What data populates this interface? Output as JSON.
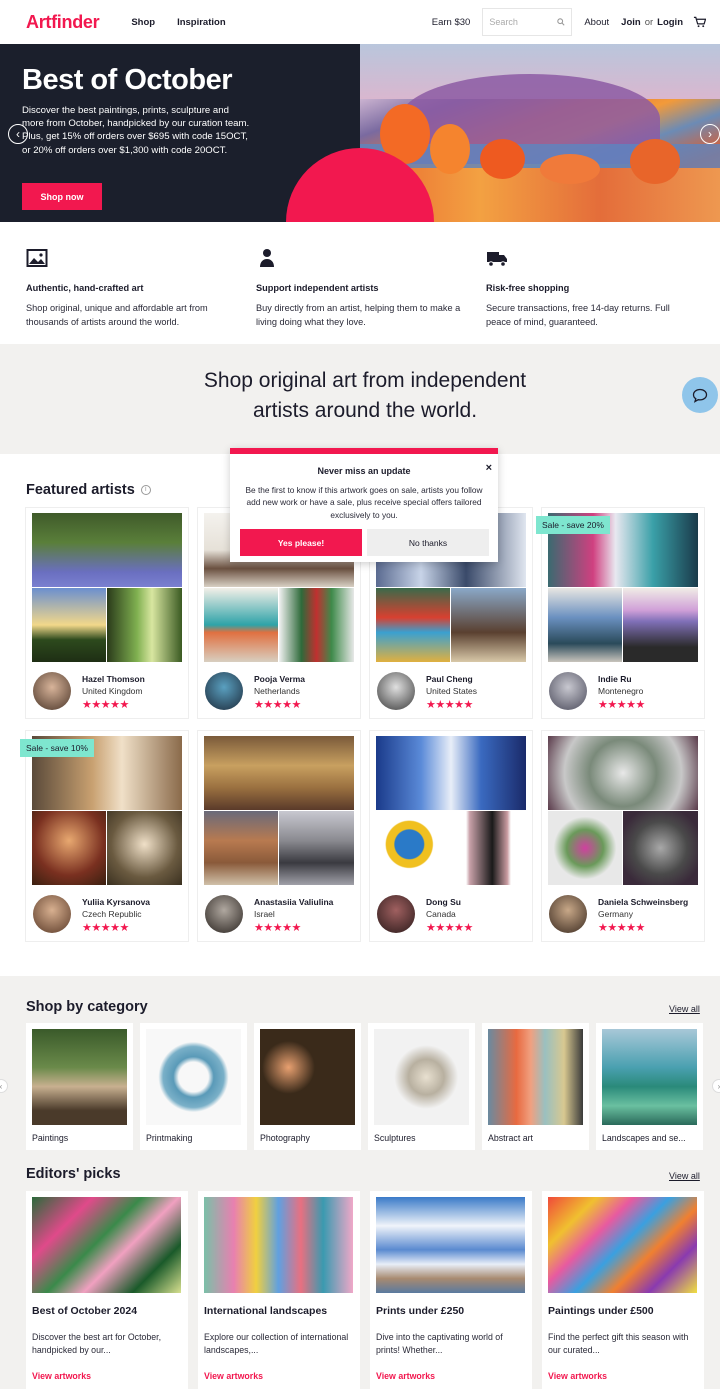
{
  "header": {
    "logo": "Artfinder",
    "nav": [
      "Shop",
      "Inspiration"
    ],
    "earn": "Earn $30",
    "search_placeholder": "Search",
    "about": "About",
    "join": "Join",
    "or": "or",
    "login": "Login"
  },
  "hero": {
    "title": "Best of October",
    "text": "Discover the best paintings, prints, sculpture and more from October, handpicked by our curation team. Plus, get 15% off orders over $695 with code 15OCT, or 20% off orders over $1,300 with code 20OCT.",
    "button": "Shop now"
  },
  "features": [
    {
      "icon": "image-icon",
      "title": "Authentic, hand-crafted art",
      "text": "Shop original, unique and affordable art from thousands of artists around the world."
    },
    {
      "icon": "person-icon",
      "title": "Support independent artists",
      "text": "Buy directly from an artist, helping them to make a living doing what they love."
    },
    {
      "icon": "truck-icon",
      "title": "Risk-free shopping",
      "text": "Secure transactions, free 14-day returns. Full peace of mind, guaranteed."
    }
  ],
  "banner": {
    "line1": "Shop original art from independent",
    "line2": "artists around the world."
  },
  "featured": {
    "title": "Featured artists",
    "artists": [
      {
        "name": "Hazel Thomson",
        "country": "United Kingdom",
        "rating": 5
      },
      {
        "name": "Pooja Verma",
        "country": "Netherlands",
        "rating": 5
      },
      {
        "name": "Paul Cheng",
        "country": "United States",
        "rating": 5
      },
      {
        "name": "Indie Ru",
        "country": "Montenegro",
        "rating": 5,
        "badge": "Sale - save 20%"
      },
      {
        "name": "Yuliia Kyrsanova",
        "country": "Czech Republic",
        "rating": 5,
        "badge": "Sale - save 10%"
      },
      {
        "name": "Anastasiia Valiulina",
        "country": "Israel",
        "rating": 5
      },
      {
        "name": "Dong Su",
        "country": "Canada",
        "rating": 5
      },
      {
        "name": "Daniela Schweinsberg",
        "country": "Germany",
        "rating": 5
      }
    ]
  },
  "popup": {
    "title": "Never miss an update",
    "text": "Be the first to know if this artwork goes on sale, artists you follow add new work or have a sale, plus receive special offers tailored exclusively to you.",
    "yes": "Yes please!",
    "no": "No thanks",
    "close": "×"
  },
  "categories": {
    "title": "Shop by category",
    "view_all": "View all",
    "items": [
      "Paintings",
      "Printmaking",
      "Photography",
      "Sculptures",
      "Abstract art",
      "Landscapes and se..."
    ]
  },
  "picks": {
    "title": "Editors' picks",
    "view_all": "View all",
    "items": [
      {
        "title": "Best of October 2024",
        "text": "Discover the best art for October, handpicked by our...",
        "link": "View artworks"
      },
      {
        "title": "International landscapes",
        "text": "Explore our collection of international landscapes,...",
        "link": "View artworks"
      },
      {
        "title": "Prints under £250",
        "text": "Dive into the captivating world of prints! Whether...",
        "link": "View artworks"
      },
      {
        "title": "Paintings under £500",
        "text": "Find the perfect gift this season with our curated...",
        "link": "View artworks"
      }
    ]
  },
  "colors": {
    "brand": "#f2184f",
    "badge": "#7ee6cf",
    "hero_bg": "#1b1f2c"
  }
}
